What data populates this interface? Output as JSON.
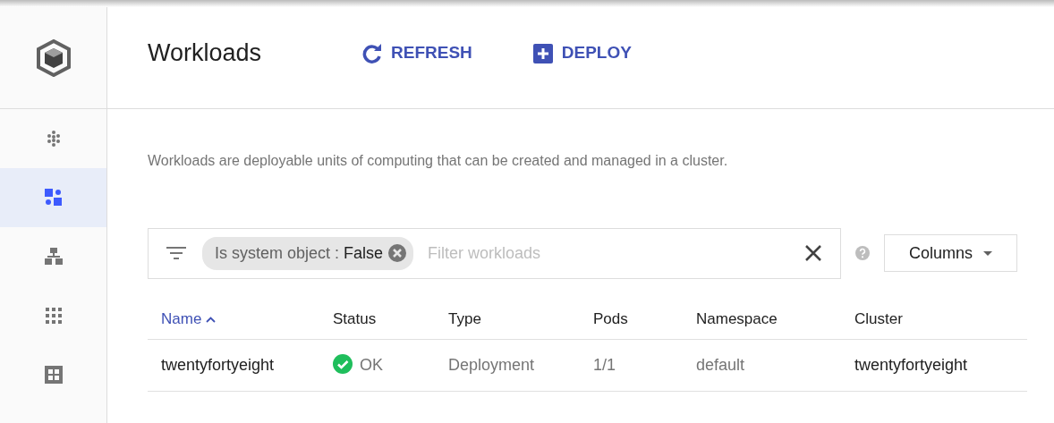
{
  "sidebar": {
    "items": [
      {
        "kind": "dots",
        "selected": false
      },
      {
        "kind": "workloads",
        "selected": true
      },
      {
        "kind": "hierarchy",
        "selected": false
      },
      {
        "kind": "grid",
        "selected": false
      },
      {
        "kind": "tiles",
        "selected": false
      }
    ]
  },
  "header": {
    "title": "Workloads",
    "actions": [
      {
        "label": "REFRESH",
        "kind": "refresh"
      },
      {
        "label": "DEPLOY",
        "kind": "deploy"
      }
    ]
  },
  "description": "Workloads are deployable units of computing that can be created and managed in a cluster.",
  "filter": {
    "chip": {
      "label": "Is system object :",
      "value": "False"
    },
    "placeholder": "Filter workloads"
  },
  "columns_button": "Columns",
  "table": {
    "columns": [
      {
        "label": "Name",
        "sorted": true
      },
      {
        "label": "Status",
        "sorted": false
      },
      {
        "label": "Type",
        "sorted": false
      },
      {
        "label": "Pods",
        "sorted": false
      },
      {
        "label": "Namespace",
        "sorted": false
      },
      {
        "label": "Cluster",
        "sorted": false
      }
    ],
    "rows": [
      {
        "name": "twentyfortyeight",
        "status": {
          "kind": "ok",
          "label": "OK"
        },
        "type": "Deployment",
        "pods": "1/1",
        "namespace": "default",
        "cluster": "twentyfortyeight"
      }
    ]
  }
}
